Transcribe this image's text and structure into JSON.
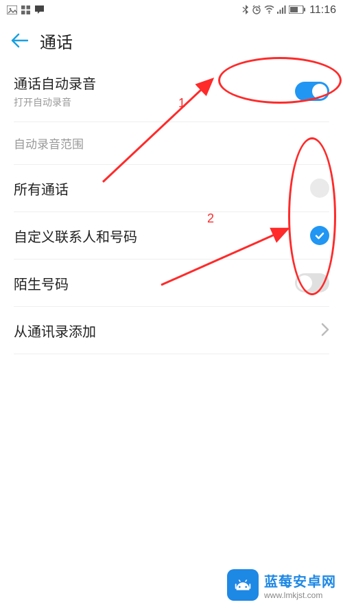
{
  "status": {
    "icons_left": [
      "gallery-icon",
      "grid-icon",
      "chat-icon"
    ],
    "icons_right": [
      "bluetooth-icon",
      "alarm-icon",
      "wifi-icon",
      "signal-icon",
      "battery-icon"
    ],
    "time": "11:16"
  },
  "header": {
    "title": "通话"
  },
  "auto_record": {
    "title": "通话自动录音",
    "subtitle": "打开自动录音",
    "enabled": true
  },
  "section_scope_title": "自动录音范围",
  "scope_options": {
    "all_calls": {
      "label": "所有通话",
      "selected": false
    },
    "custom": {
      "label": "自定义联系人和号码",
      "selected": true
    },
    "unknown": {
      "label": "陌生号码"
    }
  },
  "unknown_toggle_enabled": false,
  "add_from_contacts_label": "从通讯录添加",
  "annotations": {
    "label1": "1",
    "label2": "2"
  },
  "watermark": {
    "name": "蓝莓安卓网",
    "url": "www.lmkjst.com"
  }
}
